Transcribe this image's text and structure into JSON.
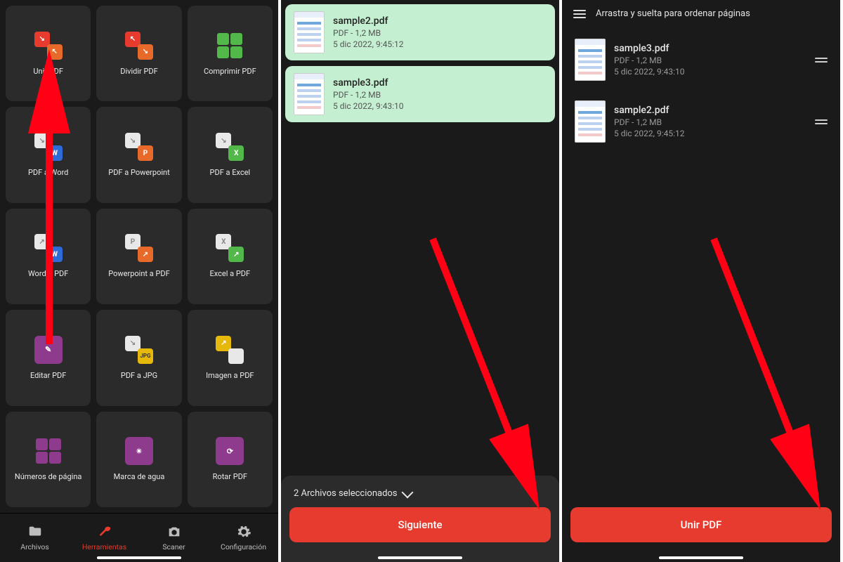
{
  "panel1": {
    "tools": [
      {
        "label": "Unir PDF"
      },
      {
        "label": "Dividir PDF"
      },
      {
        "label": "Comprimir PDF"
      },
      {
        "label": "PDF a Word"
      },
      {
        "label": "PDF a Powerpoint"
      },
      {
        "label": "PDF a Excel"
      },
      {
        "label": "Word a PDF"
      },
      {
        "label": "Powerpoint a PDF"
      },
      {
        "label": "Excel a PDF"
      },
      {
        "label": "Editar PDF"
      },
      {
        "label": "PDF a JPG"
      },
      {
        "label": "Imagen a PDF"
      },
      {
        "label": "Números de página"
      },
      {
        "label": "Marca de agua"
      },
      {
        "label": "Rotar PDF"
      }
    ],
    "tabs": {
      "files": "Archivos",
      "tools": "Herramientas",
      "scanner": "Scaner",
      "settings": "Configuración"
    }
  },
  "panel2": {
    "files": [
      {
        "name": "sample2.pdf",
        "meta": "PDF - 1,2 MB",
        "date": "5 dic 2022, 9:45:12"
      },
      {
        "name": "sample3.pdf",
        "meta": "PDF - 1,2 MB",
        "date": "5 dic 2022, 9:43:10"
      }
    ],
    "selected_label": "2 Archivos seleccionados",
    "next_button": "Siguiente"
  },
  "panel3": {
    "header": "Arrastra y suelta para ordenar páginas",
    "files": [
      {
        "name": "sample3.pdf",
        "meta": "PDF - 1,2 MB",
        "date": "5 dic 2022, 9:43:10"
      },
      {
        "name": "sample2.pdf",
        "meta": "PDF - 1,2 MB",
        "date": "5 dic 2022, 9:45:12"
      }
    ],
    "merge_button": "Unir PDF"
  },
  "colors": {
    "red": "#e63b2e",
    "blue": "#2f6bd6",
    "orange": "#e86a2b",
    "green": "#53b84a",
    "purple": "#8e3b8e",
    "yellow": "#e7b80c"
  }
}
